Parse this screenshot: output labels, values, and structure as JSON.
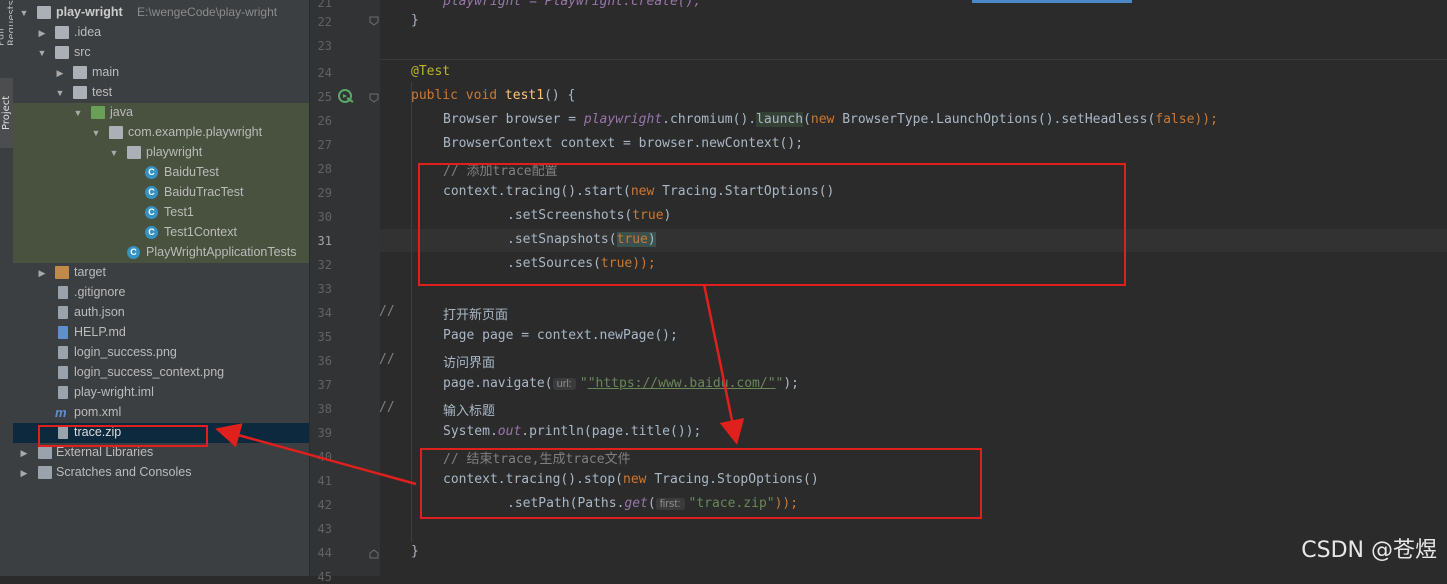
{
  "side_tabs": {
    "pull_requests": "Pull Requests",
    "project": "Project"
  },
  "tree": {
    "root": {
      "label": "play-wright",
      "path": "E:\\wengeCode\\play-wright"
    },
    "items": [
      {
        "label": ".idea"
      },
      {
        "label": "src"
      },
      {
        "label": "main"
      },
      {
        "label": "test"
      },
      {
        "label": "java"
      },
      {
        "label": "com.example.playwright"
      },
      {
        "label": "playwright"
      },
      {
        "label": "BaiduTest"
      },
      {
        "label": "BaiduTracTest"
      },
      {
        "label": "Test1"
      },
      {
        "label": "Test1Context"
      },
      {
        "label": "PlayWrightApplicationTests"
      },
      {
        "label": "target"
      },
      {
        "label": ".gitignore"
      },
      {
        "label": "auth.json"
      },
      {
        "label": "HELP.md"
      },
      {
        "label": "login_success.png"
      },
      {
        "label": "login_success_context.png"
      },
      {
        "label": "play-wright.iml"
      },
      {
        "label": "pom.xml"
      },
      {
        "label": "trace.zip"
      },
      {
        "label": "External Libraries"
      },
      {
        "label": "Scratches and Consoles"
      }
    ]
  },
  "editor": {
    "line_numbers": [
      "21",
      "22",
      "23",
      "24",
      "25",
      "26",
      "27",
      "28",
      "29",
      "30",
      "31",
      "32",
      "33",
      "34",
      "35",
      "36",
      "37",
      "38",
      "39",
      "40",
      "41",
      "42",
      "43",
      "44",
      "45"
    ],
    "code": {
      "l21": "playwright = Playwright.create();",
      "l22": "}",
      "l24": "@Test",
      "l25_kw": "public void ",
      "l25_fn": "test1",
      "l25_rest": "() {",
      "l26a": "Browser browser = ",
      "l26b": "playwright",
      "l26c": ".chromium().",
      "l26d": "launch",
      "l26e": "(",
      "l26f": "new ",
      "l26g": "BrowserType.LaunchOptions().setHeadless(",
      "l26h": "false",
      "l26i": "));",
      "l27": "BrowserContext context = browser.newContext();",
      "l28": "// 添加trace配置",
      "l29a": "context.tracing().start(",
      "l29b": "new ",
      "l29c": "Tracing.StartOptions()",
      "l30a": ".setScreenshots(",
      "l30b": "true",
      "l30c": ")",
      "l31a": ".setSnapshots(",
      "l31b": "true",
      "l31c": ")",
      "l32a": ".setSources(",
      "l32b": "true",
      "l32c": "));",
      "l34_c": "//",
      "l34": "打开新页面",
      "l35": "Page page = context.newPage();",
      "l36_c": "//",
      "l36": "访问界面",
      "l37a": "page.navigate(",
      "l37_hint": "url:",
      "l37b": "\"https://www.baidu.com/\"",
      "l37c": ");",
      "l38_c": "//",
      "l38": "输入标题",
      "l39a": "System.",
      "l39b": "out",
      "l39c": ".println(page.title());",
      "l40": "// 结束trace,生成trace文件",
      "l41a": "context.tracing().stop(",
      "l41b": "new ",
      "l41c": "Tracing.StopOptions()",
      "l42a": ".setPath(Paths.",
      "l42b": "get",
      "l42c": "(",
      "l42_hint": "first:",
      "l42d": "\"trace.zip\"",
      "l42e": "));",
      "l44": "}"
    }
  },
  "watermark": "CSDN @苍煜",
  "colors": {
    "annotation_red": "#e0201c",
    "selection": "#0d293e",
    "test_folder_bg": "#49523f"
  }
}
